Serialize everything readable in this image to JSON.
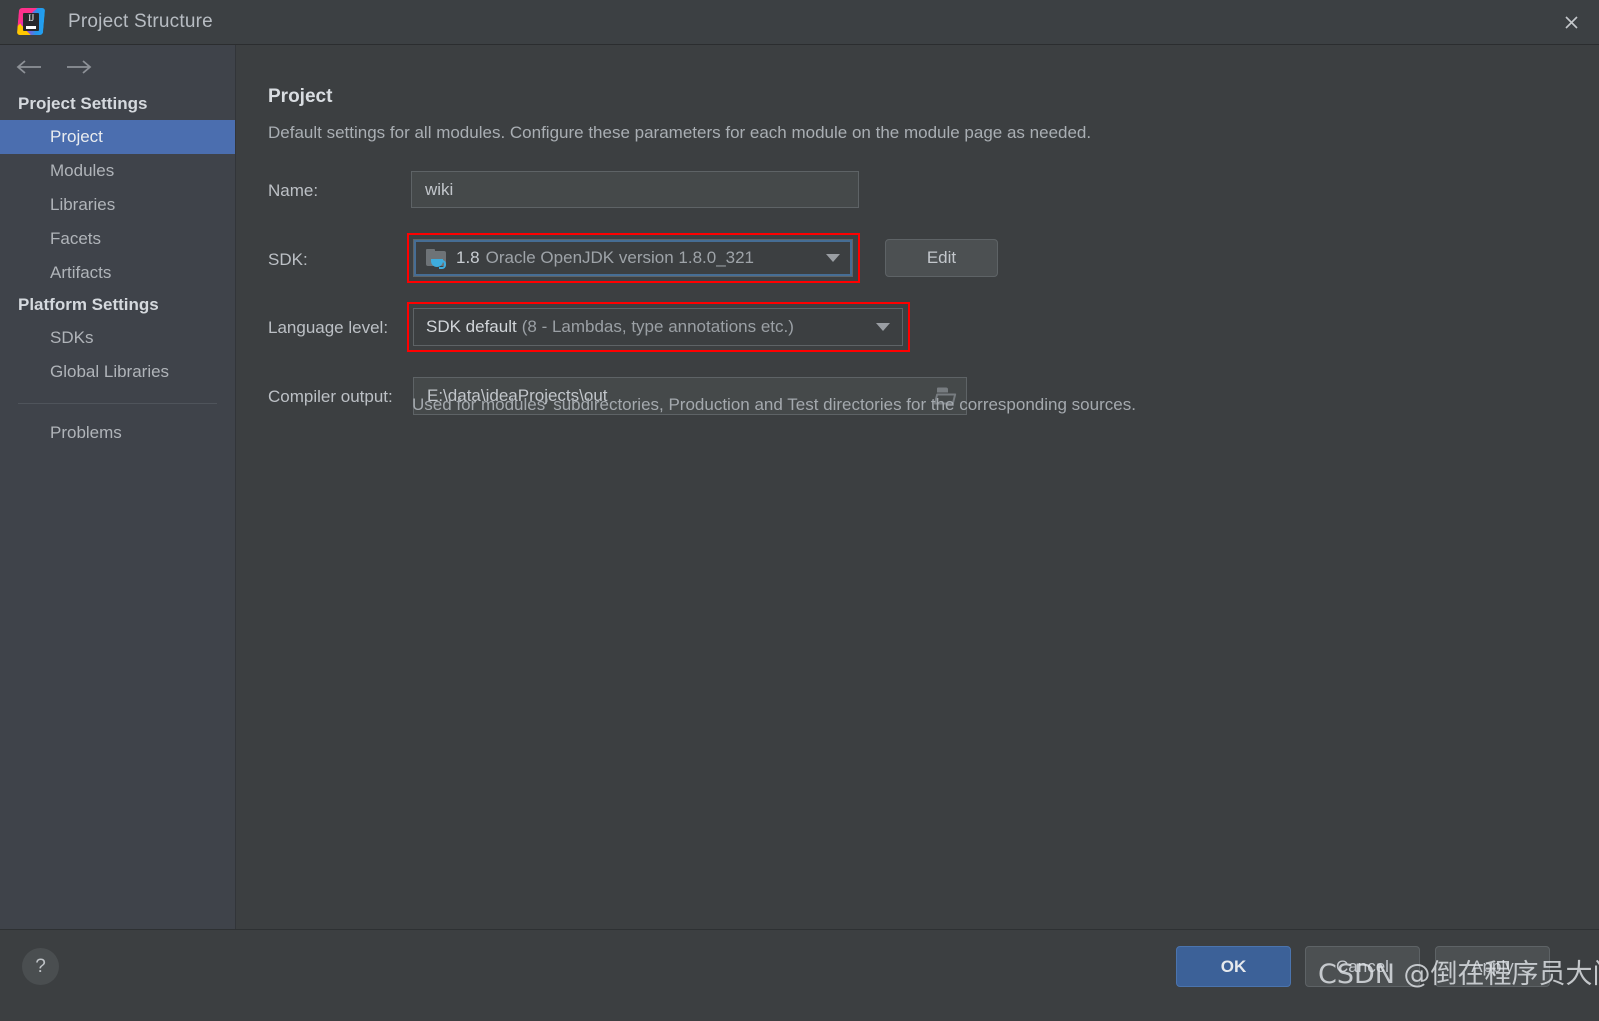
{
  "window": {
    "title": "Project Structure",
    "logo_icon": "intellij-idea-logo",
    "close_icon": "close-icon"
  },
  "nav": {
    "back_icon": "arrow-left-icon",
    "forward_icon": "arrow-right-icon"
  },
  "sidebar": {
    "groups": [
      {
        "title": "Project Settings",
        "items": [
          {
            "label": "Project",
            "selected": true
          },
          {
            "label": "Modules",
            "selected": false
          },
          {
            "label": "Libraries",
            "selected": false
          },
          {
            "label": "Facets",
            "selected": false
          },
          {
            "label": "Artifacts",
            "selected": false
          }
        ]
      },
      {
        "title": "Platform Settings",
        "items": [
          {
            "label": "SDKs",
            "selected": false
          },
          {
            "label": "Global Libraries",
            "selected": false
          }
        ]
      }
    ],
    "extra_item": {
      "label": "Problems"
    }
  },
  "main": {
    "section_title": "Project",
    "section_desc": "Default settings for all modules. Configure these parameters for each module on the module page as needed.",
    "name": {
      "label": "Name:",
      "value": "wiki"
    },
    "sdk": {
      "label": "SDK:",
      "icon": "java-sdk-folder-icon",
      "version": "1.8",
      "description": "Oracle OpenJDK version 1.8.0_321",
      "dropdown_icon": "chevron-down-icon",
      "highlighted": true,
      "edit_button": "Edit"
    },
    "language_level": {
      "label": "Language level:",
      "value": "SDK default",
      "detail": "(8 - Lambdas, type annotations etc.)",
      "dropdown_icon": "chevron-down-icon",
      "highlighted": true
    },
    "compiler_output": {
      "label": "Compiler output:",
      "value": "E:\\data\\ideaProjects\\out",
      "browse_icon": "folder-open-icon",
      "hint": "Used for modules' subdirectories, Production and Test directories for the corresponding sources."
    }
  },
  "footer": {
    "help_icon": "question-mark-icon",
    "ok_label": "OK",
    "cancel_label": "Cancel",
    "apply_label": "Apply"
  },
  "watermark": {
    "text": "CSDN @倒在程序员大门前"
  },
  "colors": {
    "window_bg": "#3c3f41",
    "sidebar_bg": "#3f434a",
    "selection_blue": "#4b6eaf",
    "ok_button_blue": "#3c6198",
    "highlight_red": "#ff0000",
    "focus_ring": "#466d94"
  }
}
